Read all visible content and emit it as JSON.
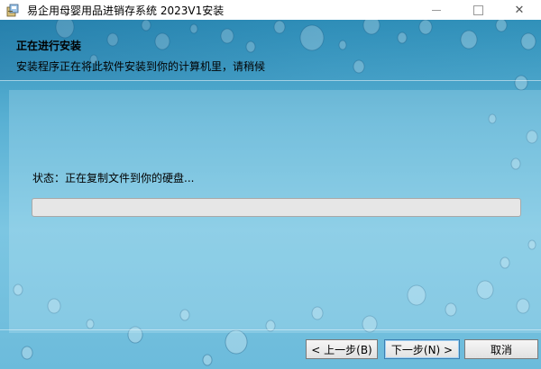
{
  "window": {
    "title": "易企用母婴用品进销存系统 2023V1安装",
    "icon": "installer-package-icon",
    "controls": {
      "minimize": "minimize-icon",
      "maximize": "maximize-icon",
      "close": "close-icon",
      "close_glyph": "✕"
    }
  },
  "header": {
    "title": "正在进行安装",
    "description": "安装程序正在将此软件安装到你的计算机里，请稍候"
  },
  "status": {
    "text": "状态：正在复制文件到你的硬盘..."
  },
  "progress": {
    "value": 0
  },
  "buttons": {
    "back": "< 上一步(B)",
    "next": "下一步(N) >",
    "cancel": "取消"
  },
  "colors": {
    "background": "#5ab1d4",
    "progress_track": "#e6e6e6",
    "button_face": "#e1e1e1"
  }
}
